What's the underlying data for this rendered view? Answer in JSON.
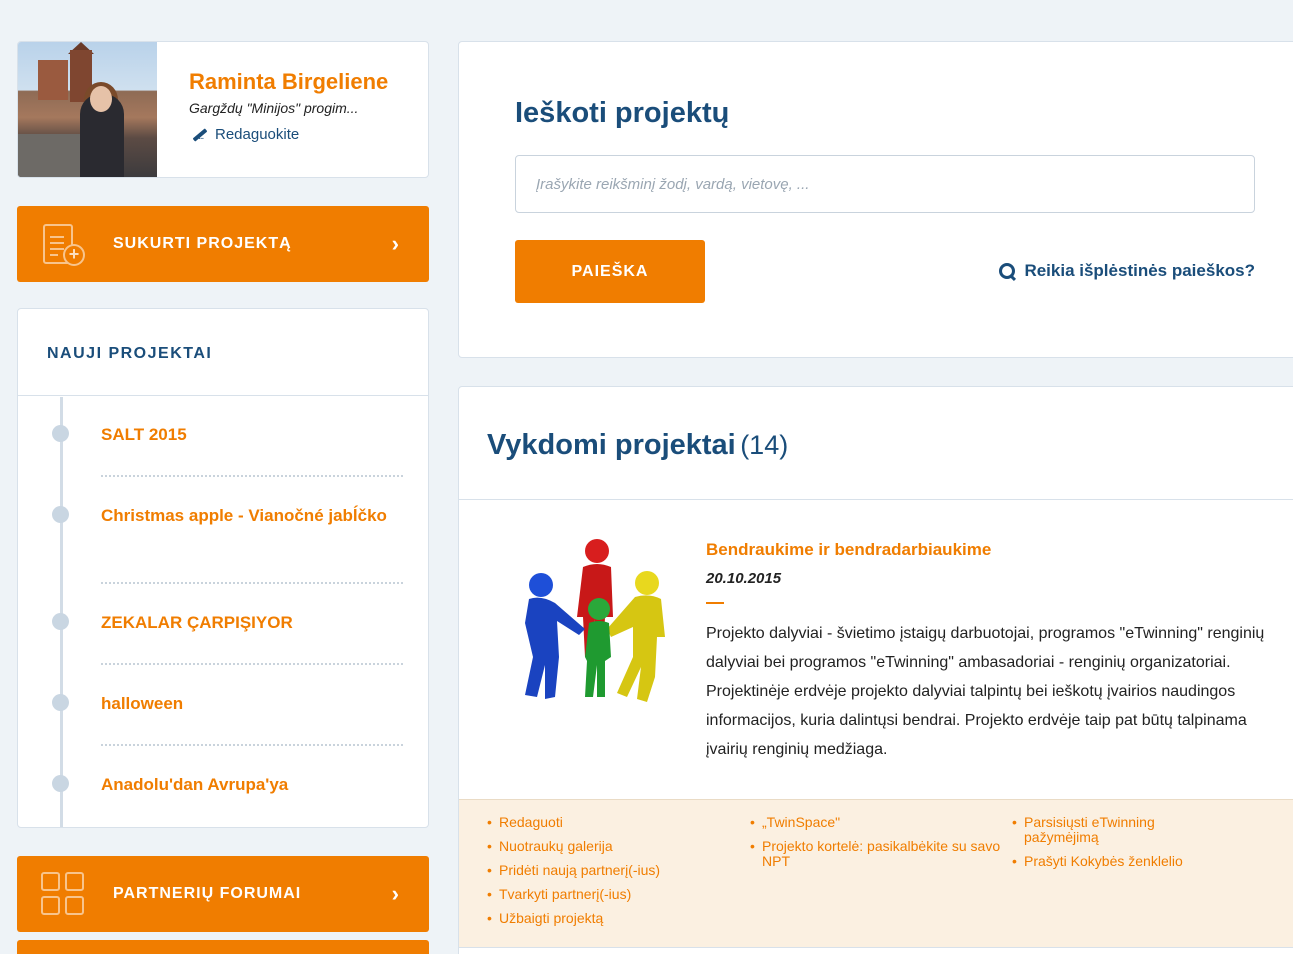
{
  "profile": {
    "name": "Raminta Birgeliene",
    "school": "Gargždų \"Minijos\" progim...",
    "edit_label": "Redaguokite"
  },
  "create_project": {
    "label": "SUKURTI PROJEKTĄ",
    "chevron": "›",
    "icon": "document-plus-icon"
  },
  "new_projects": {
    "heading": "NAUJI PROJEKTAI",
    "items": [
      {
        "title": "SALT 2015"
      },
      {
        "title": "Christmas apple - Vianočné jabĺčko"
      },
      {
        "title": "ZEKALAR ÇARPIŞIYOR"
      },
      {
        "title": "halloween"
      },
      {
        "title": "Anadolu'dan Avrupa'ya"
      }
    ]
  },
  "partner_forums": {
    "label": "PARTNERIŲ FORUMAI",
    "chevron": "›",
    "icon": "grid-icon"
  },
  "search": {
    "heading": "Ieškoti projektų",
    "placeholder": "Įrašykite reikšminį žodį, vardą, vietovę, ...",
    "button_label": "PAIEŠKA",
    "advanced_label": "Reikia išplėstinės paieškos?"
  },
  "active_projects": {
    "heading": "Vykdomi projektai",
    "count": "(14)",
    "project": {
      "title": "Bendraukime ir bendradarbiaukime",
      "date": "20.10.2015",
      "description_p1": "Projekto dalyviai - švietimo įstaigų darbuotojai, programos \"eTwinning\" renginių dalyviai bei programos \"eTwinning\" ambasadoriai - renginių organizatoriai.",
      "description_p2": "Projektinėje erdvėje projekto dalyviai talpintų bei ieškotų įvairios naudingos informacijos, kuria dalintųsi bendrai. Projekto erdvėje taip pat būtų talpinama įvairių renginių medžiaga."
    },
    "links": {
      "col1": [
        "Redaguoti",
        "Nuotraukų galerija",
        "Pridėti naują partnerį(-ius)",
        "Tvarkyti partnerį(-ius)",
        "Užbaigti projektą"
      ],
      "col2": [
        "„TwinSpace\"",
        "Projekto kortelė: pasikalbėkite su savo NPT"
      ],
      "col3": [
        "Parsisiųsti eTwinning pažymėjimą",
        "Prašyti Kokybės ženklelio"
      ]
    }
  },
  "colors": {
    "accent": "#f07d00",
    "primary": "#1a4d7a",
    "background": "#eef3f7"
  }
}
